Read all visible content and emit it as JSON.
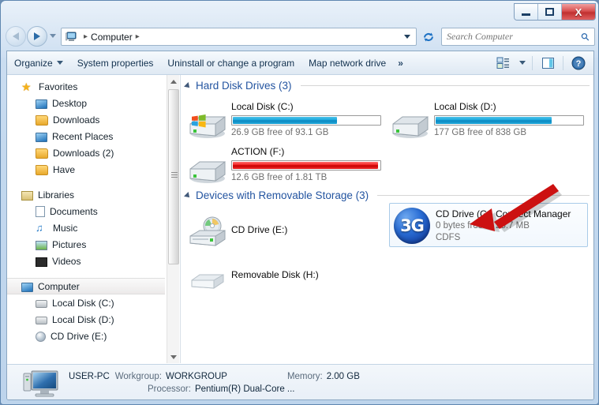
{
  "window": {
    "titlebar": {
      "minimize_label": "Minimize",
      "maximize_label": "Maximize",
      "close_label": "X"
    }
  },
  "addressbar": {
    "back_label": "Back",
    "forward_label": "Forward",
    "crumb": "Computer",
    "separator": "▸",
    "refresh_label": "↻"
  },
  "search": {
    "placeholder": "Search Computer",
    "value": "",
    "icon": "search-icon"
  },
  "commandbar": {
    "items": [
      {
        "label": "Organize",
        "has_caret": true
      },
      {
        "label": "System properties",
        "has_caret": false
      },
      {
        "label": "Uninstall or change a program",
        "has_caret": false
      },
      {
        "label": "Map network drive",
        "has_caret": false
      }
    ],
    "overflow": "»",
    "right_icons": [
      "views-icon",
      "views-caret-icon",
      "preview-pane-icon",
      "help-icon"
    ],
    "help_glyph": "?"
  },
  "sidebar": {
    "groups": [
      {
        "name": "Favorites",
        "icon": "star-icon",
        "items": [
          {
            "label": "Desktop",
            "icon": "desktop-icon"
          },
          {
            "label": "Downloads",
            "icon": "downloads-icon"
          },
          {
            "label": "Recent Places",
            "icon": "recent-places-icon"
          },
          {
            "label": "Downloads (2)",
            "icon": "folder-icon"
          },
          {
            "label": "Have",
            "icon": "folder-icon"
          }
        ]
      },
      {
        "name": "Libraries",
        "icon": "library-icon",
        "items": [
          {
            "label": "Documents",
            "icon": "document-icon"
          },
          {
            "label": "Music",
            "icon": "music-icon"
          },
          {
            "label": "Pictures",
            "icon": "picture-icon"
          },
          {
            "label": "Videos",
            "icon": "video-icon"
          }
        ]
      },
      {
        "name": "Computer",
        "icon": "computer-icon",
        "selected": true,
        "items": [
          {
            "label": "Local Disk (C:)",
            "icon": "windows-disk-icon"
          },
          {
            "label": "Local Disk (D:)",
            "icon": "hdd-icon"
          },
          {
            "label": "CD Drive (E:)",
            "icon": "cd-icon"
          }
        ]
      }
    ]
  },
  "content": {
    "sections": [
      {
        "id": "hard-disk-drives",
        "label": "Hard Disk Drives (3)",
        "expanded": true
      },
      {
        "id": "removable-storage",
        "label": "Devices with Removable Storage (3)",
        "expanded": true
      }
    ],
    "drives": [
      {
        "id": "local-disk-c",
        "name": "Local Disk (C:)",
        "capacity_text": "26.9 GB free of 93.1 GB",
        "free_gb": 26.9,
        "total_gb": 93.1,
        "used_percent": 71,
        "bar_color": "#19a8dd",
        "icon": "windows-hdd-icon",
        "has_bar": true
      },
      {
        "id": "local-disk-d",
        "name": "Local Disk (D:)",
        "capacity_text": "177 GB free of 838 GB",
        "free_gb": 177,
        "total_gb": 838,
        "used_percent": 79,
        "bar_color": "#19a8dd",
        "icon": "hdd-icon",
        "has_bar": true
      },
      {
        "id": "action-f",
        "name": "ACTION (F:)",
        "capacity_text": "12.6 GB free of 1.81 TB",
        "free_gb": 12.6,
        "total_gb": 1853,
        "used_percent": 99,
        "bar_color": "#f02020",
        "icon": "hdd-icon",
        "has_bar": true
      },
      {
        "id": "cd-drive-e",
        "name": "CD Drive (E:)",
        "capacity_text": "",
        "icon": "cd-drive-icon",
        "has_bar": false
      },
      {
        "id": "removable-disk-h",
        "name": "Removable Disk (H:)",
        "capacity_text": "",
        "icon": "removable-disk-icon",
        "has_bar": false
      },
      {
        "id": "cd-drive-g",
        "name": "CD Drive (G:) Connect Manager",
        "capacity_text": "0 bytes free of 25.7 MB",
        "filesystem": "CDFS",
        "icon": "3g-disc-icon",
        "icon_text": "3G",
        "has_bar": false,
        "highlighted": true
      }
    ]
  },
  "details_pane": {
    "computer_name": "USER-PC",
    "workgroup_key": "Workgroup:",
    "workgroup_value": "WORKGROUP",
    "memory_key": "Memory:",
    "memory_value": "2.00 GB",
    "processor_key": "Processor:",
    "processor_value": "Pentium(R) Dual-Core  ...",
    "icon": "computer-icon"
  },
  "annotation": {
    "arrow_color": "#cc1111",
    "points_to": "cd-drive-g"
  }
}
